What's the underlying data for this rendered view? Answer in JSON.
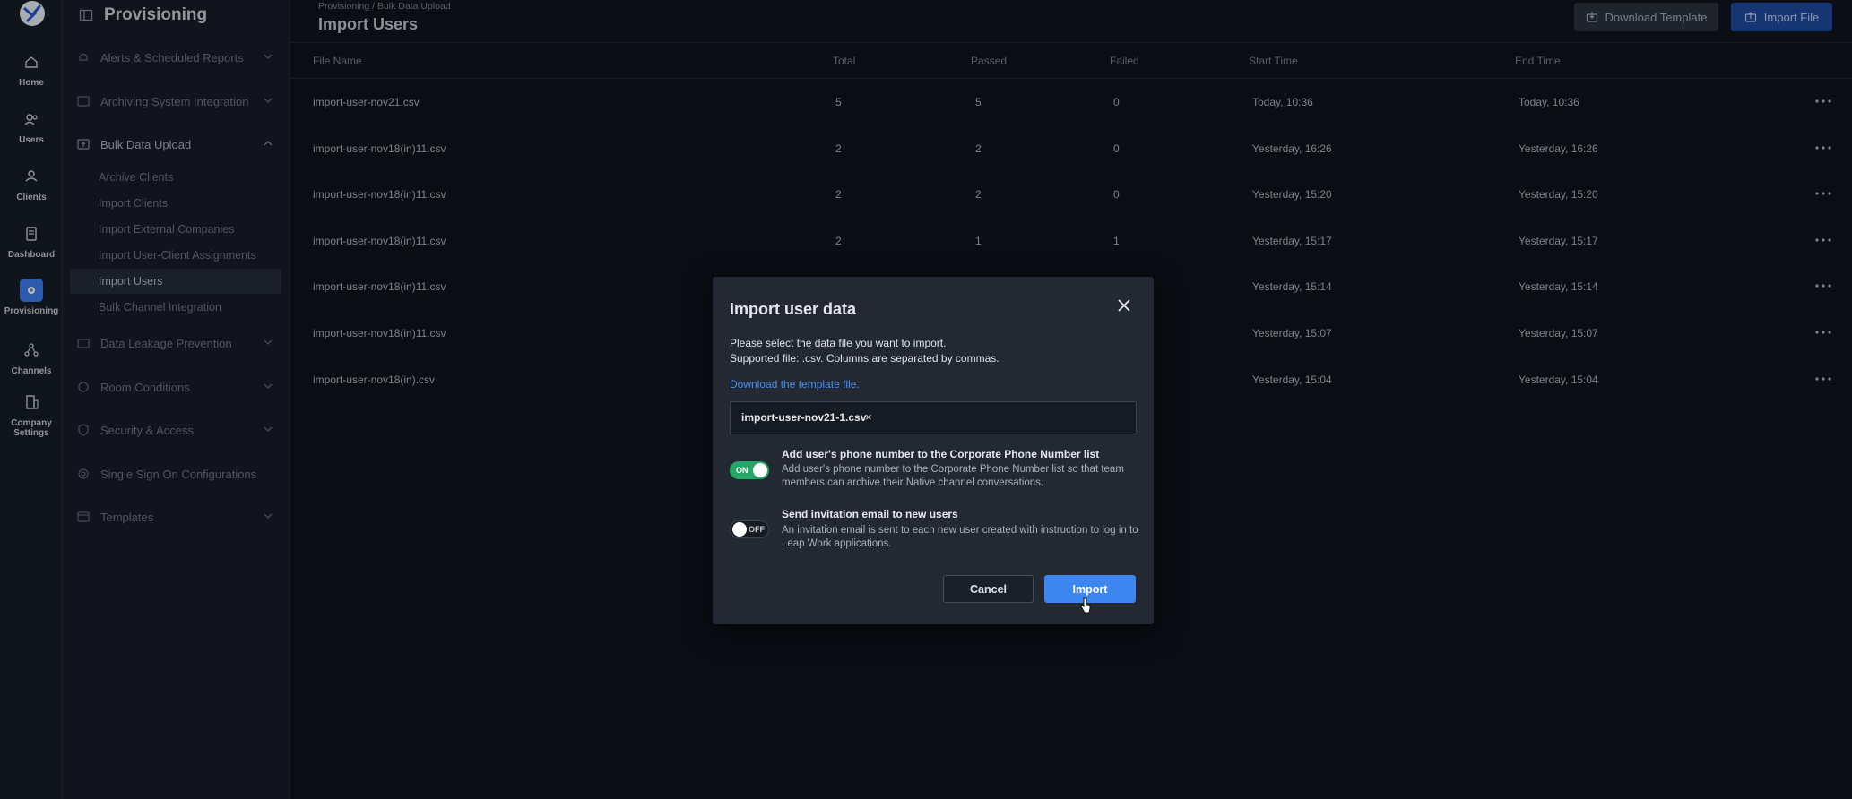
{
  "rail": {
    "items": [
      {
        "label": "Home",
        "icon": "home-icon"
      },
      {
        "label": "Users",
        "icon": "users-icon"
      },
      {
        "label": "Clients",
        "icon": "clients-icon"
      },
      {
        "label": "Dashboard",
        "icon": "dashboard-icon"
      },
      {
        "label": "Provisioning",
        "icon": "gear-icon",
        "active": true
      },
      {
        "label": "Channels",
        "icon": "channels-icon"
      },
      {
        "label": "Company",
        "label2": "Settings",
        "icon": "building-icon"
      }
    ]
  },
  "sidebar": {
    "title": "Provisioning",
    "sections": [
      {
        "label": "Alerts & Scheduled Reports"
      },
      {
        "label": "Archiving System Integration"
      },
      {
        "label": "Bulk Data Upload"
      },
      {
        "label": "Data Leakage Prevention"
      },
      {
        "label": "Room Conditions"
      },
      {
        "label": "Security & Access"
      },
      {
        "label": "Single Sign On Configurations"
      },
      {
        "label": "Templates"
      }
    ],
    "subitems": [
      {
        "label": "Archive Clients"
      },
      {
        "label": "Import Clients"
      },
      {
        "label": "Import External Companies"
      },
      {
        "label": "Import User-Client Assignments"
      },
      {
        "label": "Import Users"
      },
      {
        "label": "Bulk Channel Integration"
      }
    ]
  },
  "header": {
    "breadcrumb": "Provisioning / Bulk Data Upload",
    "title": "Import Users",
    "download_template": "Download Template",
    "import_file": "Import File"
  },
  "table": {
    "columns": [
      "File Name",
      "Total",
      "Passed",
      "Failed",
      "Start Time",
      "End Time"
    ],
    "rows": [
      {
        "file": "import-user-nov21.csv",
        "total": "5",
        "passed": "5",
        "failed": "0",
        "start": "Today, 10:36",
        "end": "Today, 10:36"
      },
      {
        "file": "import-user-nov18(in)11.csv",
        "total": "2",
        "passed": "2",
        "failed": "0",
        "start": "Yesterday, 16:26",
        "end": "Yesterday, 16:26"
      },
      {
        "file": "import-user-nov18(in)11.csv",
        "total": "2",
        "passed": "2",
        "failed": "0",
        "start": "Yesterday, 15:20",
        "end": "Yesterday, 15:20"
      },
      {
        "file": "import-user-nov18(in)11.csv",
        "total": "2",
        "passed": "1",
        "failed": "1",
        "start": "Yesterday, 15:17",
        "end": "Yesterday, 15:17"
      },
      {
        "file": "import-user-nov18(in)11.csv",
        "total": "",
        "passed": "",
        "failed": "",
        "start": "Yesterday, 15:14",
        "end": "Yesterday, 15:14"
      },
      {
        "file": "import-user-nov18(in)11.csv",
        "total": "",
        "passed": "",
        "failed": "",
        "start": "Yesterday, 15:07",
        "end": "Yesterday, 15:07"
      },
      {
        "file": "import-user-nov18(in).csv",
        "total": "",
        "passed": "",
        "failed": "",
        "start": "Yesterday, 15:04",
        "end": "Yesterday, 15:04"
      }
    ]
  },
  "modal": {
    "title": "Import user data",
    "desc1": "Please select the data file you want to import.",
    "desc2": "Supported file: .csv. Columns are separated by commas.",
    "template_link": "Download the template file.",
    "selected_file": "import-user-nov21-1.csv",
    "remove_file": "×",
    "option1": {
      "title": "Add user's phone number to the Corporate Phone Number list",
      "desc": "Add user's phone number to the Corporate Phone Number list so that team members can archive their Native channel conversations.",
      "state": "ON"
    },
    "option2": {
      "title": "Send invitation email to new users",
      "desc": "An invitation email is sent to each new user created with instruction to log in to Leap Work applications.",
      "state": "OFF"
    },
    "cancel": "Cancel",
    "import": "Import"
  },
  "colors": {
    "accent": "#3d85f0",
    "toggle_on": "#25a866",
    "link": "#4a8ff0"
  }
}
